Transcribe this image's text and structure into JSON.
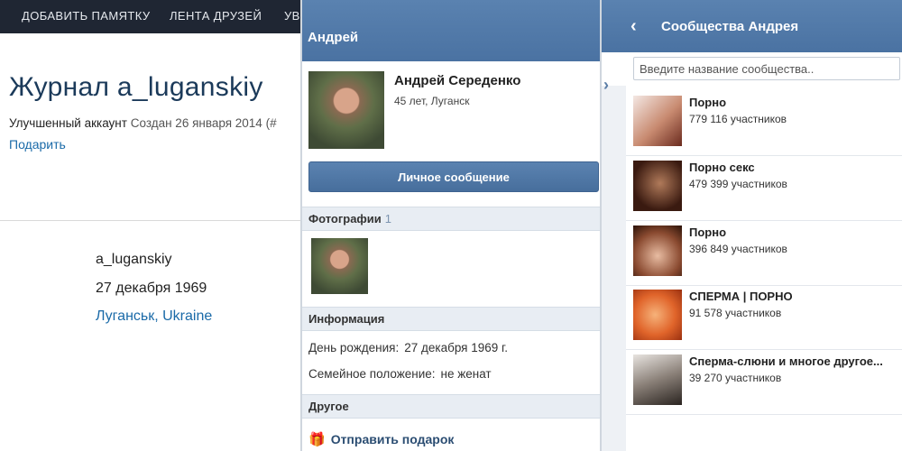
{
  "lj": {
    "nav": [
      "ДОБАВИТЬ ПАМЯТКУ",
      "ЛЕНТА ДРУЗЕЙ",
      "УВ"
    ],
    "journal_title": "Журнал a_luganskiy",
    "account_type": "Улучшенный аккаунт",
    "created": "Создан 26 января 2014 (#",
    "gift_link": "Подарить",
    "username": "a_luganskiy",
    "birthdate": "27 декабря 1969",
    "city": "Луганськ",
    "country": "Ukraine"
  },
  "profile": {
    "header_title": "Андрей",
    "name": "Андрей Середенко",
    "subtitle": "45 лет, Луганск",
    "message_button": "Личное сообщение",
    "photos_label": "Фотографии",
    "photos_count": "1",
    "info_label": "Информация",
    "birthday_label": "День рождения:",
    "birthday_value": "27 декабря 1969 г.",
    "marital_label": "Семейное положение:",
    "marital_value": "не женат",
    "other_label": "Другое",
    "send_gift": "Отправить подарок"
  },
  "communities": {
    "header_title": "Сообщества Андрея",
    "search_placeholder": "Введите название сообщества..",
    "items": [
      {
        "title": "Порно",
        "members": "779 116 участников"
      },
      {
        "title": "Порно секс",
        "members": "479 399 участников"
      },
      {
        "title": "Порно",
        "members": "396 849 участников"
      },
      {
        "title": "СПЕРМА | ПОРНО",
        "members": "91 578 участников"
      },
      {
        "title": "Сперма-слюни и многое другое...",
        "members": "39 270 участников"
      }
    ]
  },
  "icons": {
    "back": "chevron-left-icon",
    "side": "chevron-right-icon",
    "gift": "gift-icon"
  }
}
